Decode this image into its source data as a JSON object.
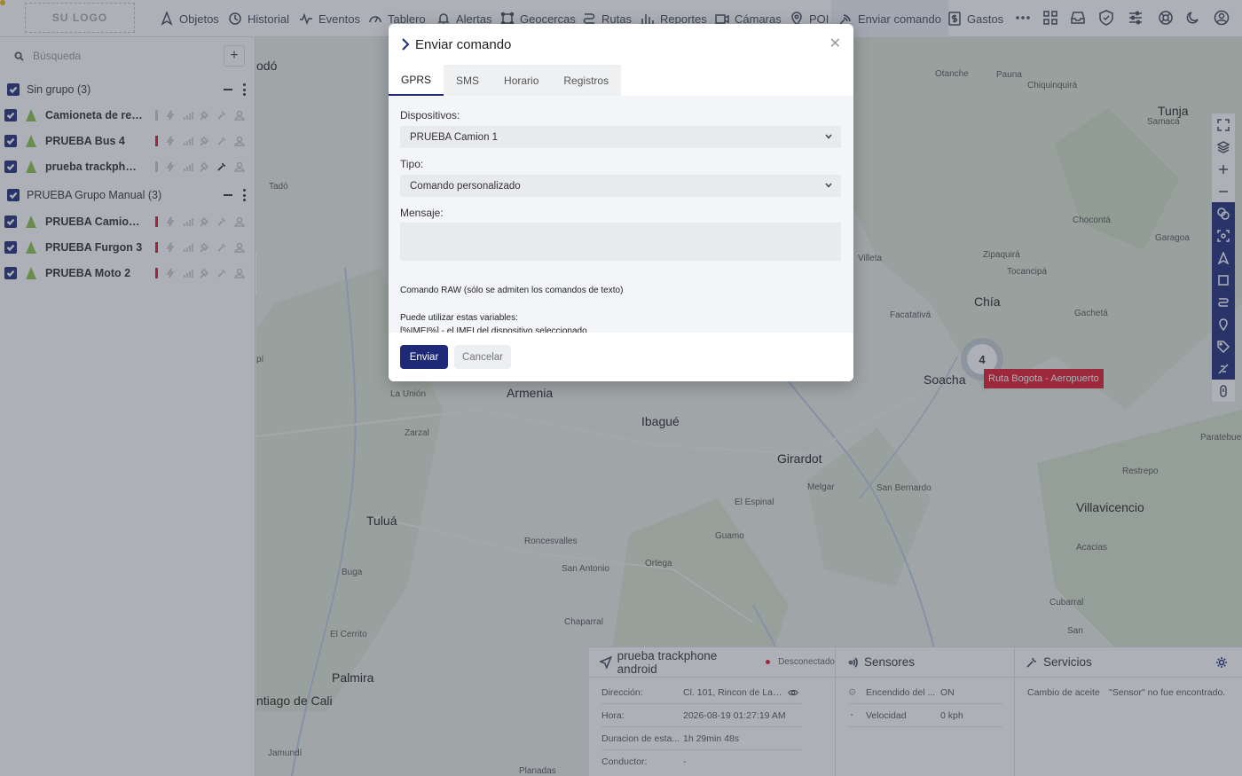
{
  "logo": {
    "text": "SU LOGO"
  },
  "nav": {
    "items": [
      {
        "label": "Objetos",
        "icon": "navigation-icon"
      },
      {
        "label": "Historial",
        "icon": "history-icon"
      },
      {
        "label": "Eventos",
        "icon": "pulse-icon"
      },
      {
        "label": "Tablero",
        "icon": "dashboard-icon"
      },
      {
        "label": "Alertas",
        "icon": "bell-icon"
      },
      {
        "label": "Geocercas",
        "icon": "geofence-icon"
      },
      {
        "label": "Rutas",
        "icon": "route-icon"
      },
      {
        "label": "Reportes",
        "icon": "bar-chart-icon"
      },
      {
        "label": "Cámaras",
        "icon": "camera-icon"
      },
      {
        "label": "POI",
        "icon": "pin-icon"
      },
      {
        "label": "Enviar comando",
        "icon": "signal-icon"
      },
      {
        "label": "Gastos",
        "icon": "dollar-icon"
      }
    ],
    "active": "Enviar comando"
  },
  "sidebar": {
    "search_placeholder": "Búsqueda",
    "groups": [
      {
        "name": "Sin grupo (3)",
        "devices": [
          {
            "name": "Camioneta de rep...",
            "status": "offline"
          },
          {
            "name": "PRUEBA Bus 4",
            "status": "alert"
          },
          {
            "name": "prueba trackphon...",
            "status": "offline"
          }
        ]
      },
      {
        "name": "PRUEBA Grupo Manual (3)",
        "devices": [
          {
            "name": "PRUEBA Camion 1",
            "status": "alert"
          },
          {
            "name": "PRUEBA Furgon 3",
            "status": "alert"
          },
          {
            "name": "PRUEBA Moto 2",
            "status": "alert"
          }
        ]
      }
    ]
  },
  "map": {
    "cities": [
      "Chía",
      "Soacha",
      "Armenia",
      "Ibagué",
      "Girardot",
      "Tuluá",
      "Villavicencio",
      "Palmira",
      "Tunja",
      "ntiago de Cali",
      "odó"
    ],
    "towns": [
      "Otanche",
      "Pauna",
      "Chiquinquirá",
      "Samacá",
      "Chocontá",
      "Garagoa",
      "Zipaquirá",
      "Tocancipá",
      "Villeta",
      "Facatativá",
      "Gachetá",
      "La Unión",
      "Zarzal",
      "Melgar",
      "San Bernardo",
      "El Espinal",
      "Guamo",
      "Paratebueno",
      "Restrepo",
      "Acacias",
      "Roncesvalles",
      "San Antonio",
      "Ortega",
      "Buga",
      "Chaparral",
      "El Cerrito",
      "Cubarral",
      "San",
      "Jamundí",
      "Planadas",
      "Tadó",
      "pí"
    ],
    "cluster_count": "4",
    "route_label": "Ruta Bogota - Aeropuerto"
  },
  "bottom": {
    "device": {
      "title": "prueba trackphone android",
      "status": "Desconectado",
      "rows": [
        {
          "key": "Dirección:",
          "value": "Cl. 101, Rincon de La P..."
        },
        {
          "key": "Hora:",
          "value": "2026-08-19 01:27:19 AM"
        },
        {
          "key": "Duracion de esta...",
          "value": "1h 29min 48s"
        },
        {
          "key": "Conductor:",
          "value": "-"
        }
      ]
    },
    "sensors": {
      "title": "Sensores",
      "rows": [
        {
          "key": "Encendido del ...",
          "value": "ON"
        },
        {
          "key": "Velocidad",
          "value": "0 kph"
        }
      ]
    },
    "services": {
      "title": "Servicios",
      "rows": [
        {
          "key": "Cambio de aceite",
          "value": "\"Sensor\" no fue encontrado."
        }
      ]
    }
  },
  "modal": {
    "title": "Enviar comando",
    "tabs": [
      "GPRS",
      "SMS",
      "Horario",
      "Registros"
    ],
    "active_tab": "GPRS",
    "devices_label": "Dispositivos:",
    "devices_value": "PRUEBA Camion 1",
    "type_label": "Tipo:",
    "type_value": "Comando personalizado",
    "message_label": "Mensaje:",
    "message_value": "",
    "raw_hint": "Comando RAW (sólo se admiten los comandos de texto)",
    "vars_title": "Puede utilizar estas variables:",
    "vars_line": "[%IMEI%] - el IMEI del dispositivo seleccionado",
    "send_label": "Enviar",
    "cancel_label": "Cancelar"
  },
  "colors": {
    "primary": "#1e2a78",
    "alert": "#e0182a",
    "device_icon": "#8bc34a"
  }
}
